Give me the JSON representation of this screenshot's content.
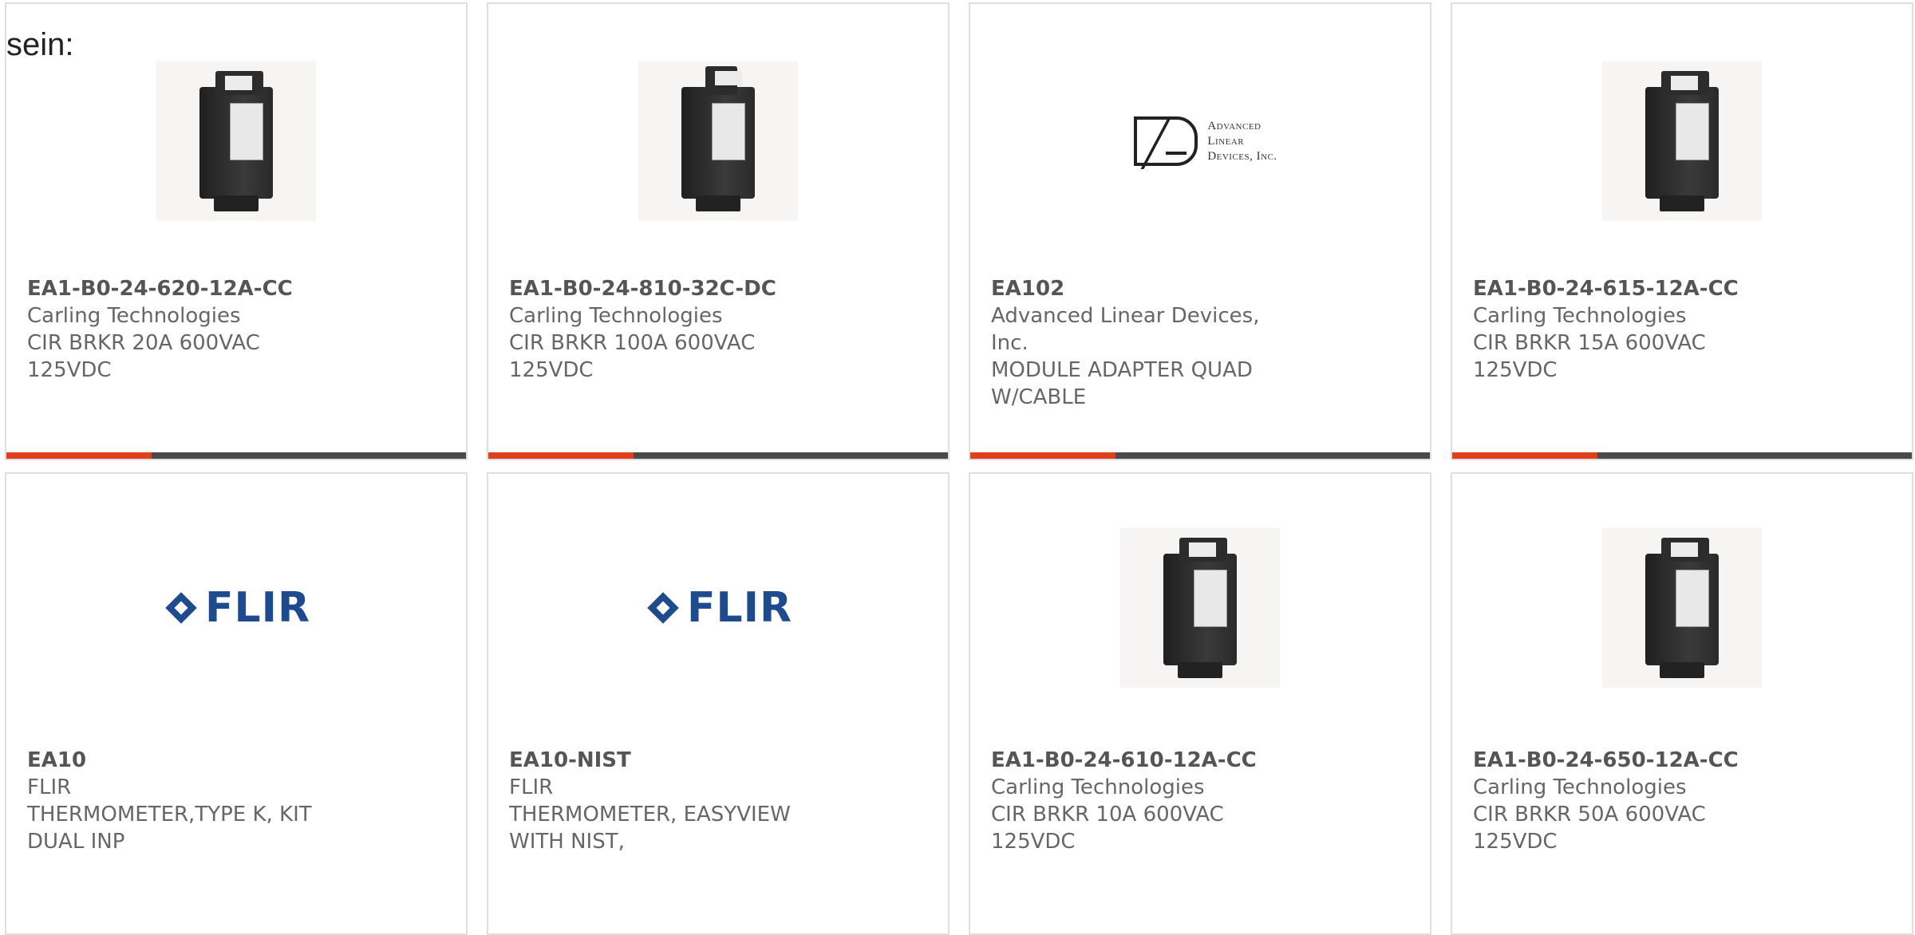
{
  "intro_text": "sein:",
  "cards": [
    {
      "part_number": "EA1-B0-24-620-12A-CC",
      "manufacturer": "Carling Technologies",
      "description": "CIR BRKR 20A 600VAC 125VDC",
      "image": "circuit-breaker-photo"
    },
    {
      "part_number": "EA1-B0-24-810-32C-DC",
      "manufacturer": "Carling Technologies",
      "description": "CIR BRKR 100A 600VAC 125VDC",
      "image": "circuit-breaker-photo"
    },
    {
      "part_number": "EA102",
      "manufacturer": "Advanced Linear Devices, Inc.",
      "description": "MODULE ADAPTER QUAD W/CABLE",
      "image": "ald-logo",
      "logo_text": [
        "Advanced",
        "Linear",
        "Devices, Inc."
      ]
    },
    {
      "part_number": "EA1-B0-24-615-12A-CC",
      "manufacturer": "Carling Technologies",
      "description": "CIR BRKR 15A 600VAC 125VDC",
      "image": "circuit-breaker-photo"
    },
    {
      "part_number": "EA10",
      "manufacturer": "FLIR",
      "description": "THERMOMETER,TYPE K, KIT DUAL INP",
      "image": "flir-logo",
      "logo_text": "FLIR"
    },
    {
      "part_number": "EA10-NIST",
      "manufacturer": "FLIR",
      "description": "THERMOMETER, EASYVIEW WITH NIST,",
      "image": "flir-logo",
      "logo_text": "FLIR"
    },
    {
      "part_number": "EA1-B0-24-610-12A-CC",
      "manufacturer": "Carling Technologies",
      "description": "CIR BRKR 10A 600VAC 125VDC",
      "image": "circuit-breaker-photo"
    },
    {
      "part_number": "EA1-B0-24-650-12A-CC",
      "manufacturer": "Carling Technologies",
      "description": "CIR BRKR 50A 600VAC 125VDC",
      "image": "circuit-breaker-photo"
    }
  ],
  "colors": {
    "accent": "#e0401c",
    "bar_dark": "#4a4a4a",
    "flir_blue": "#1e4a8e",
    "card_border": "#dedede"
  }
}
